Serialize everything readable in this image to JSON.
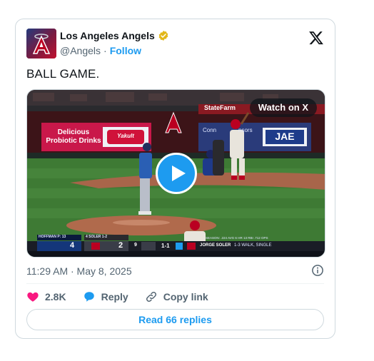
{
  "account": {
    "name": "Los Angeles Angels",
    "handle": "@Angels",
    "separator": "·",
    "follow_label": "Follow"
  },
  "tweet": {
    "text": "BALL GAME.",
    "timestamp": "11:29 AM · May 8, 2025"
  },
  "media": {
    "watch_label": "Watch on X",
    "scoreboard": {
      "away_team_score": "4",
      "home_team_score": "2",
      "inning": "9",
      "count": "1-1",
      "pitcher_label": "HOFFMAN P: 13",
      "batter_label": "4 SOLER 1-2",
      "batter_name": "JORGE SOLER",
      "batter_stats": "1-3 WALK, SINGLE",
      "season_stats": "SEASON: .224 AVG 6 HR 13 RBI .712 OPS"
    },
    "signage": {
      "ad_text_line1": "Delicious",
      "ad_text_line2": "Probiotic Drinks",
      "brand_1": "Yakult",
      "brand_2": "StateFarm",
      "brand_3": "JAE",
      "sponsor_partial": "Conn",
      "sponsor_partial_2": "nsors"
    }
  },
  "actions": {
    "likes_count": "2.8K",
    "reply_label": "Reply",
    "copy_link_label": "Copy link"
  },
  "read_replies_label": "Read 66 replies",
  "colors": {
    "accent": "#1d9bf0",
    "like": "#f91880",
    "angels_red": "#ba0021",
    "verified_gold": "#e2b719"
  }
}
